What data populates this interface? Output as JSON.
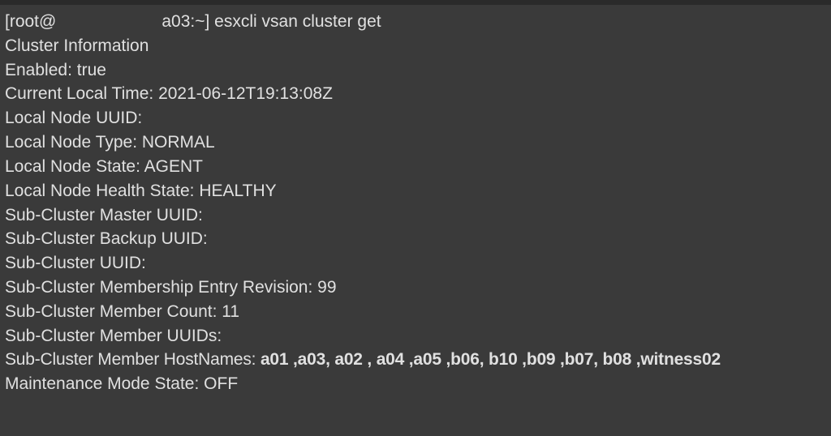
{
  "prompt": {
    "user": "[root@",
    "host_suffix": "a03:~]",
    "command": "esxcli vsan cluster get"
  },
  "output": {
    "header": "Cluster Information",
    "lines": {
      "enabled": "Enabled: true",
      "current_local_time": "Current Local Time: 2021-06-12T19:13:08Z",
      "local_node_uuid": "Local Node UUID:",
      "local_node_type": "Local Node Type: NORMAL",
      "local_node_state": "Local Node State: AGENT",
      "local_node_health": "Local Node Health State: HEALTHY",
      "sub_master_uuid": "Sub-Cluster Master UUID:",
      "sub_backup_uuid": "Sub-Cluster Backup UUID:",
      "sub_uuid": "Sub-Cluster UUID:",
      "sub_membership_rev": "Sub-Cluster Membership Entry Revision: 99",
      "sub_member_count": "Sub-Cluster Member Count: 11",
      "sub_member_uuids": "Sub-Cluster Member UUIDs:",
      "sub_member_hostnames_label": "Sub-Cluster Member HostNames:",
      "sub_member_hostnames_value": "a01 ,a03, a02 , a04 ,a05 ,b06, b10 ,b09 ,b07, b08 ,witness02",
      "maintenance_mode": "Maintenance Mode State: OFF"
    }
  }
}
